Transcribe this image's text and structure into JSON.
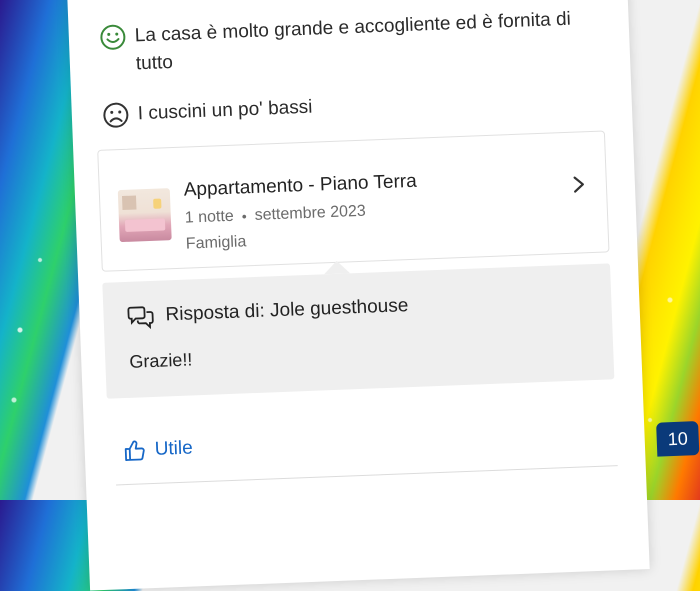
{
  "review": {
    "positive": "La casa è molto grande e accogliente ed è fornita di tutto",
    "negative": "I cuscini un po' bassi"
  },
  "property": {
    "name": "Appartamento - Piano Terra",
    "nights": "1 notte",
    "date": "settembre 2023",
    "traveler_type": "Famiglia"
  },
  "response": {
    "header": "Risposta di: Jole guesthouse",
    "text": "Grazie!!"
  },
  "actions": {
    "helpful_label": "Utile"
  },
  "score": {
    "value": "10"
  },
  "colors": {
    "positive_icon": "#3a8a3a",
    "link_blue": "#1667c7",
    "score_bg": "#0a3a7a",
    "reply_bg": "#efefef"
  },
  "icons": {
    "positive": "smiley-happy-icon",
    "negative": "smiley-sad-icon",
    "chevron": "chevron-right-icon",
    "reply": "chat-bubbles-icon",
    "helpful": "thumbs-up-icon"
  }
}
